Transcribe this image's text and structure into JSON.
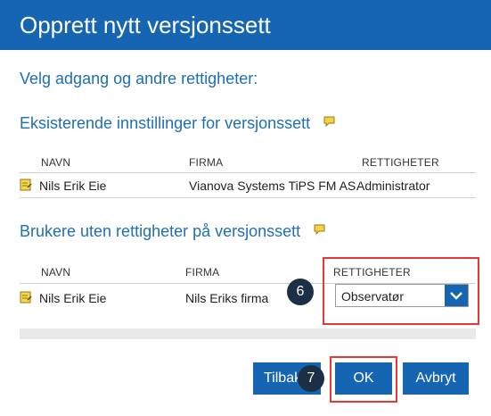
{
  "dialog": {
    "title": "Opprett nytt versjonssett"
  },
  "headings": {
    "main": "Velg adgang og andre rettigheter:",
    "existing": "Eksisterende innstillinger for versjonssett",
    "users": "Brukere uten rettigheter på versjonssett"
  },
  "existing_table": {
    "columns": [
      "NAVN",
      "FIRMA",
      "RETTIGHETER"
    ],
    "rows": [
      {
        "name": "Nils Erik Eie",
        "company": "Vianova Systems TiPS FM AS",
        "rights": "Administrator"
      }
    ]
  },
  "users_table": {
    "columns": [
      "NAVN",
      "FIRMA",
      "RETTIGHETER"
    ],
    "rows": [
      {
        "name": "Nils Erik Eie",
        "company": "Nils Eriks firma",
        "rights": "Observatør"
      }
    ]
  },
  "annotations": {
    "badge_6": "6",
    "badge_7": "7"
  },
  "buttons": {
    "back": "Tilbake",
    "ok": "OK",
    "cancel": "Avbryt"
  },
  "colors": {
    "primary": "#1565b3",
    "heading": "#1f6fb5",
    "highlight": "#e53935",
    "badge": "#1c2f44"
  },
  "icons": {
    "heading_icon": "comment-icon",
    "row_icon": "user-note-icon",
    "dropdown_icon": "chevron-down-icon"
  }
}
